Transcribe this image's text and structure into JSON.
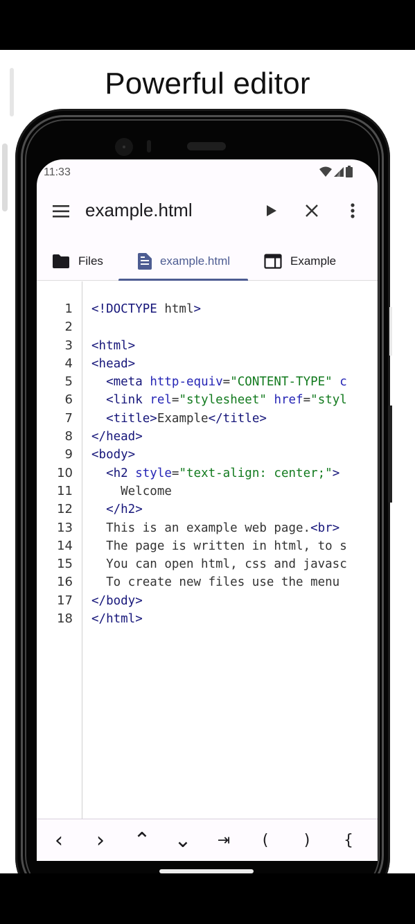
{
  "promo": {
    "title": "Powerful editor"
  },
  "status_bar": {
    "time": "11:33",
    "icons": [
      "wifi-icon",
      "signal-icon",
      "battery-icon"
    ]
  },
  "app_bar": {
    "title": "example.html",
    "actions": [
      "menu-icon",
      "run-icon",
      "close-icon",
      "more-vert-icon"
    ]
  },
  "tabs": [
    {
      "label": "Files",
      "icon": "folder-icon",
      "selected": false
    },
    {
      "label": "example.html",
      "icon": "document-icon",
      "selected": true
    },
    {
      "label": "Example",
      "icon": "web-preview-icon",
      "selected": false
    }
  ],
  "colors": {
    "accent": "#4d5c92",
    "tag": "#16167a",
    "attribute": "#2525b5",
    "string": "#127a1e",
    "text": "#333333"
  },
  "code": {
    "lines": [
      {
        "num": "1",
        "tokens": [
          [
            "tag",
            "<!DOCTYPE"
          ],
          [
            "text",
            " html"
          ],
          [
            "tag",
            ">"
          ]
        ]
      },
      {
        "num": "2",
        "tokens": []
      },
      {
        "num": "3",
        "tokens": [
          [
            "tag",
            "<html>"
          ]
        ]
      },
      {
        "num": "4",
        "tokens": [
          [
            "tag",
            "<head>"
          ]
        ]
      },
      {
        "num": "5",
        "tokens": [
          [
            "text",
            "  "
          ],
          [
            "tag",
            "<meta"
          ],
          [
            "text",
            " "
          ],
          [
            "attr",
            "http-equiv"
          ],
          [
            "text",
            "="
          ],
          [
            "str",
            "\"CONTENT-TYPE\""
          ],
          [
            "text",
            " "
          ],
          [
            "attr",
            "c"
          ]
        ]
      },
      {
        "num": "6",
        "tokens": [
          [
            "text",
            "  "
          ],
          [
            "tag",
            "<link"
          ],
          [
            "text",
            " "
          ],
          [
            "attr",
            "rel"
          ],
          [
            "text",
            "="
          ],
          [
            "str",
            "\"stylesheet\""
          ],
          [
            "text",
            " "
          ],
          [
            "attr",
            "href"
          ],
          [
            "text",
            "="
          ],
          [
            "str",
            "\"styl"
          ]
        ]
      },
      {
        "num": "7",
        "tokens": [
          [
            "text",
            "  "
          ],
          [
            "tag",
            "<title>"
          ],
          [
            "text",
            "Example"
          ],
          [
            "tag",
            "</title>"
          ]
        ]
      },
      {
        "num": "8",
        "tokens": [
          [
            "tag",
            "</head>"
          ]
        ]
      },
      {
        "num": "9",
        "tokens": [
          [
            "tag",
            "<body>"
          ]
        ]
      },
      {
        "num": "10",
        "tokens": [
          [
            "text",
            "  "
          ],
          [
            "tag",
            "<h2"
          ],
          [
            "text",
            " "
          ],
          [
            "attr",
            "style"
          ],
          [
            "text",
            "="
          ],
          [
            "str",
            "\"text-align: center;\""
          ],
          [
            "tag",
            ">"
          ]
        ]
      },
      {
        "num": "11",
        "tokens": [
          [
            "text",
            "    Welcome"
          ]
        ]
      },
      {
        "num": "12",
        "tokens": [
          [
            "text",
            "  "
          ],
          [
            "tag",
            "</h2>"
          ]
        ]
      },
      {
        "num": "13",
        "tokens": [
          [
            "text",
            "  This is an example web page."
          ],
          [
            "tag",
            "<br>"
          ]
        ]
      },
      {
        "num": "14",
        "tokens": [
          [
            "text",
            "  The page is written in html, to s"
          ]
        ]
      },
      {
        "num": "15",
        "tokens": [
          [
            "text",
            "  You can open html, css and javasc"
          ]
        ]
      },
      {
        "num": "16",
        "tokens": [
          [
            "text",
            "  To create new files use the menu "
          ]
        ]
      },
      {
        "num": "17",
        "tokens": [
          [
            "tag",
            "</body>"
          ]
        ]
      },
      {
        "num": "18",
        "tokens": [
          [
            "tag",
            "</html>"
          ]
        ]
      }
    ]
  },
  "key_bar": {
    "keys": [
      {
        "label": "<",
        "name": "key-cursor-left"
      },
      {
        "label": ">",
        "name": "key-cursor-right"
      },
      {
        "label": "^",
        "name": "key-cursor-up"
      },
      {
        "label": "v",
        "name": "key-cursor-down"
      },
      {
        "label": "→|",
        "name": "key-tab"
      },
      {
        "label": "(",
        "name": "key-open-paren"
      },
      {
        "label": ")",
        "name": "key-close-paren"
      },
      {
        "label": "{",
        "name": "key-open-brace"
      }
    ]
  }
}
